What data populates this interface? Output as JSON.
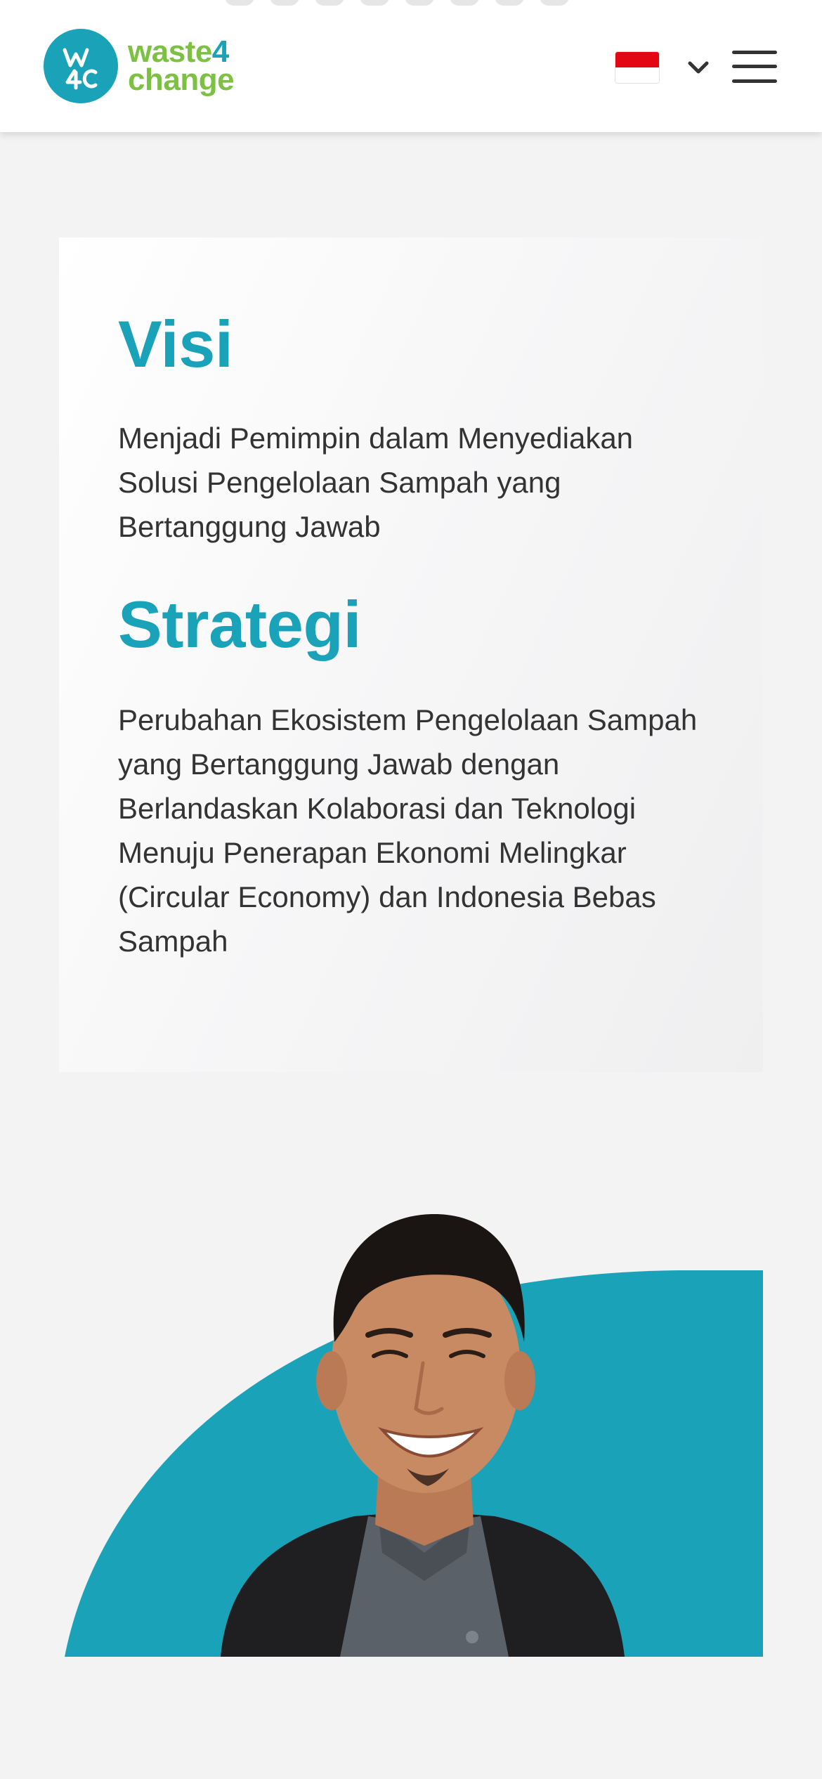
{
  "header": {
    "logo": {
      "monogram": "W4C",
      "line1": "waste",
      "line1_number": "4",
      "line2": "change"
    },
    "language": {
      "selected": "Bahasa Indonesia",
      "flag_colors": [
        "#e30613",
        "#ffffff"
      ]
    },
    "menu_icon": "hamburger-menu-icon"
  },
  "vision_card": {
    "visi_heading": "Visi",
    "visi_text": "Menjadi Pemimpin dalam Menyediakan Solusi Pengelolaan Sampah yang Bertanggung Jawab",
    "strategi_heading": "Strategi",
    "strategi_text": "Perubahan Ekosistem Pengelolaan Sampah yang Bertanggung Jawab dengan Berlandaskan Kolaborasi dan Teknologi Menuju Penerapan Ekonomi Melingkar (Circular Economy) dan Indonesia Bebas Sampah"
  },
  "portrait": {
    "subject": "smiling man in dark blazer and grey shirt",
    "background_accent": "#1aa3b8"
  },
  "colors": {
    "brand_teal": "#1aa3b8",
    "brand_green": "#7cc142",
    "page_bg": "#f3f3f4",
    "text": "#333333"
  }
}
